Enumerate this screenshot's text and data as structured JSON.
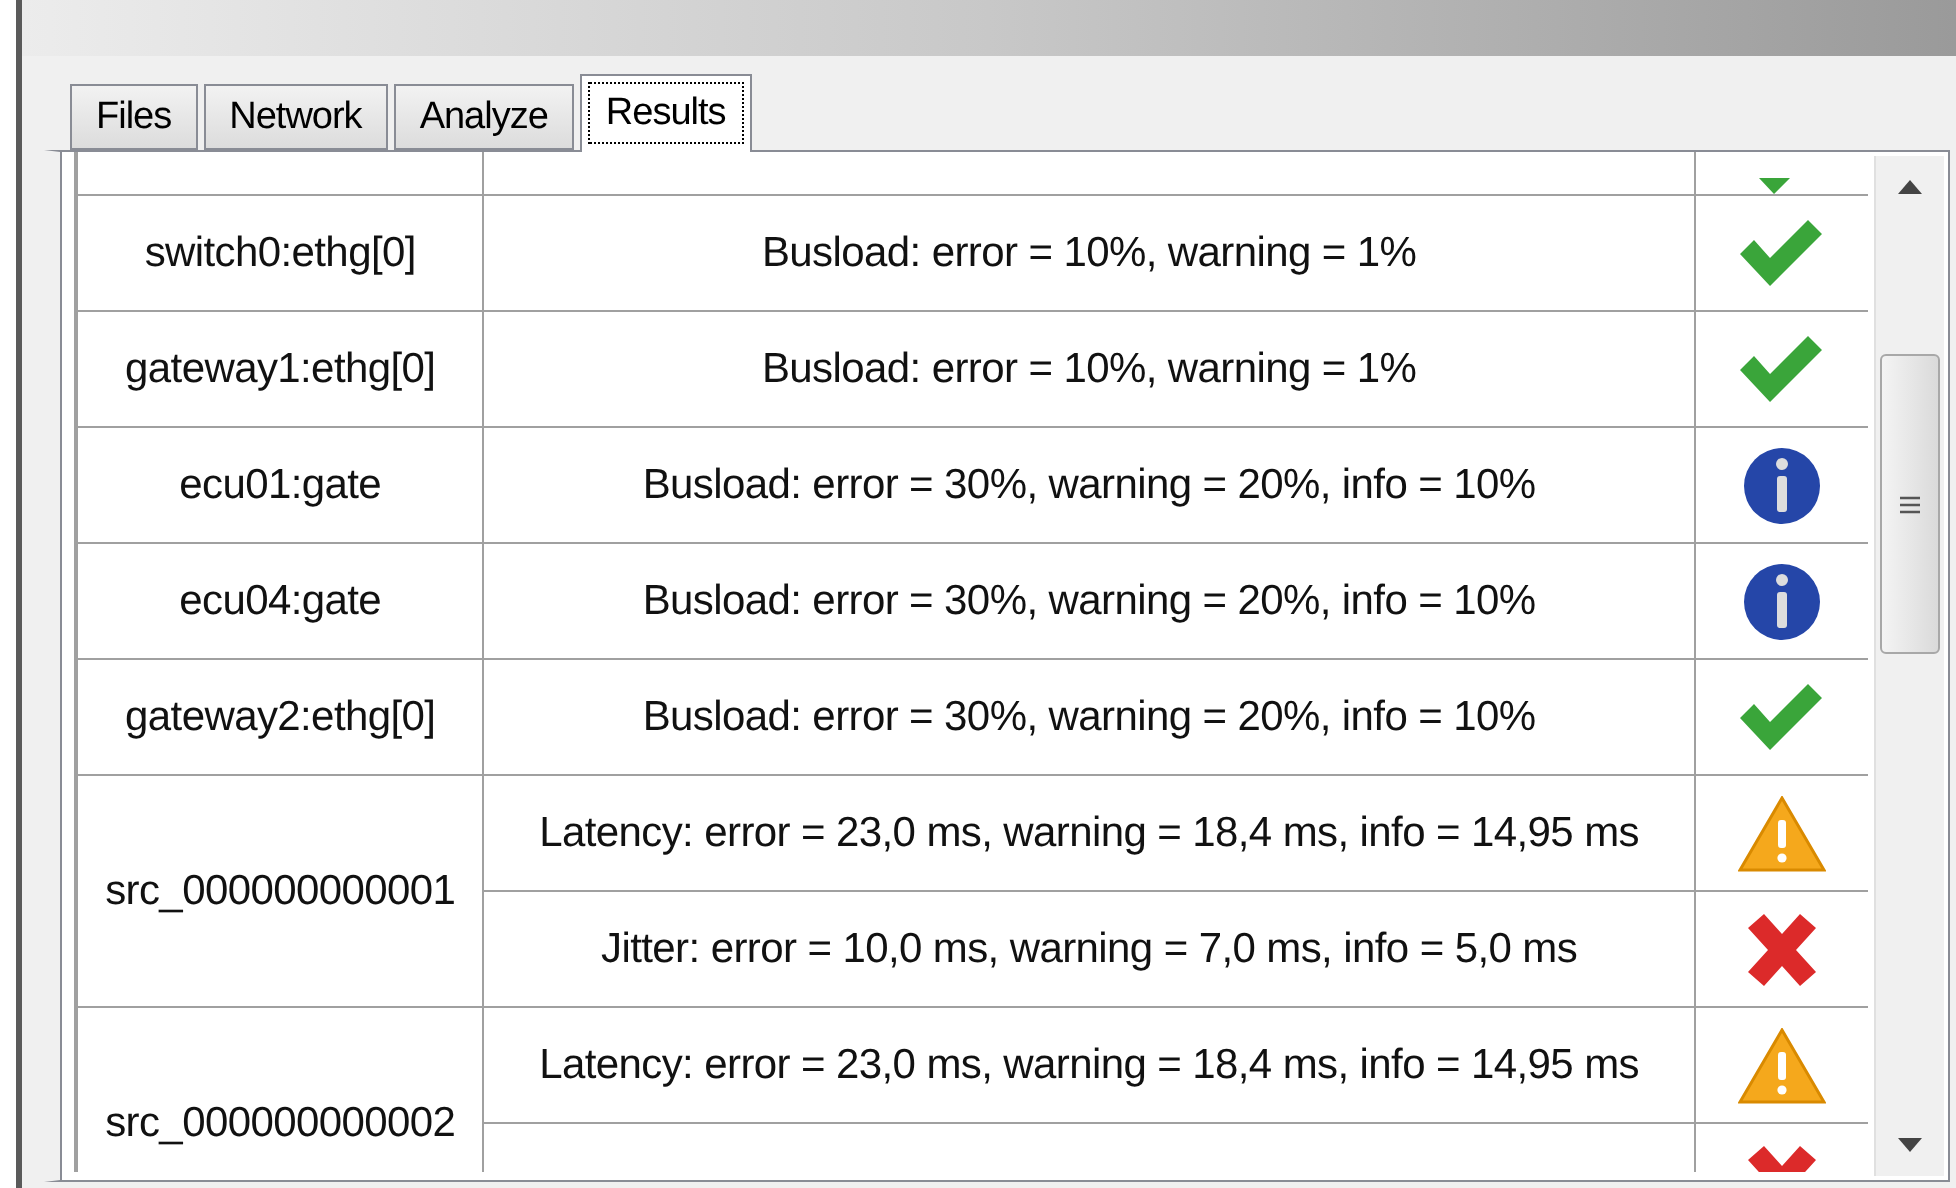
{
  "tabs": [
    {
      "label": "Files",
      "selected": false
    },
    {
      "label": "Network",
      "selected": false
    },
    {
      "label": "Analyze",
      "selected": false
    },
    {
      "label": "Results",
      "selected": true
    }
  ],
  "results": [
    {
      "checks": [
        {
          "kind": "ok"
        }
      ]
    },
    {
      "name": "switch0:ethg[0]",
      "checks": [
        {
          "description": "Busload: error = 10%, warning = 1%",
          "kind": "ok"
        }
      ]
    },
    {
      "name": "gateway1:ethg[0]",
      "checks": [
        {
          "description": "Busload: error = 10%, warning = 1%",
          "kind": "ok"
        }
      ]
    },
    {
      "name": "ecu01:gate",
      "checks": [
        {
          "description": "Busload: error = 30%, warning = 20%, info = 10%",
          "kind": "info"
        }
      ]
    },
    {
      "name": "ecu04:gate",
      "checks": [
        {
          "description": "Busload: error = 30%, warning = 20%, info = 10%",
          "kind": "info"
        }
      ]
    },
    {
      "name": "gateway2:ethg[0]",
      "checks": [
        {
          "description": "Busload: error = 30%, warning = 20%, info = 10%",
          "kind": "ok"
        }
      ]
    },
    {
      "name": "src_000000000001",
      "checks": [
        {
          "description": "Latency: error = 23,0 ms, warning = 18,4 ms, info = 14,95 ms",
          "kind": "warning"
        },
        {
          "description": "Jitter: error = 10,0 ms, warning = 7,0 ms, info = 5,0 ms",
          "kind": "error"
        }
      ]
    },
    {
      "name": "src_000000000002",
      "checks": [
        {
          "description": "Latency: error = 23,0 ms, warning = 18,4 ms, info = 14,95 ms",
          "kind": "warning"
        },
        {
          "kind": "error"
        }
      ]
    }
  ]
}
